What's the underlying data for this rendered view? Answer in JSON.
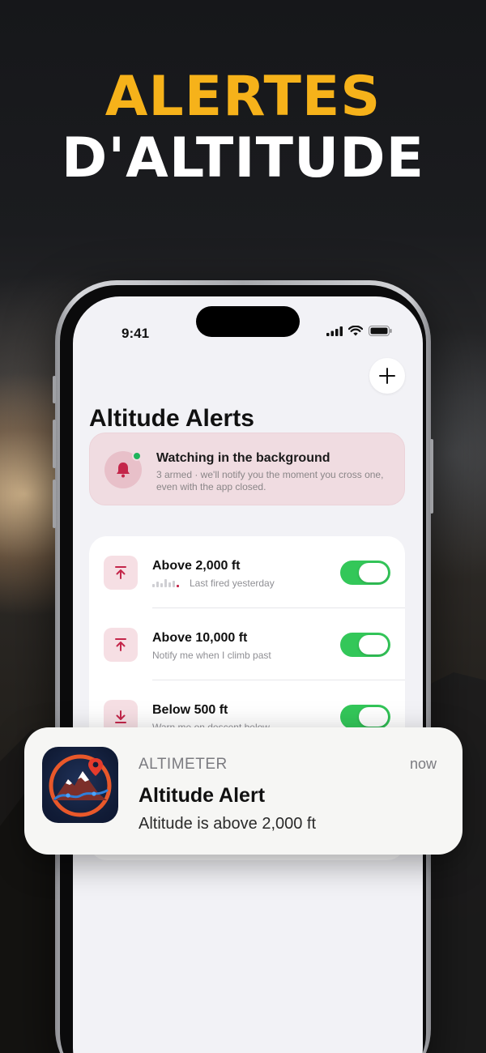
{
  "headline": {
    "line1": "ALERTES",
    "line2": "D'ALTITUDE"
  },
  "status_bar": {
    "time": "9:41"
  },
  "page": {
    "title": "Altitude Alerts"
  },
  "banner": {
    "title": "Watching in the background",
    "subtitle": "3 armed · we'll notify you the moment you cross one, even with the app closed.",
    "status_dot_color": "#1fb35b"
  },
  "alerts": [
    {
      "title": "Above 2,000 ft",
      "subtitle": "Last fired yesterday",
      "direction": "up",
      "enabled": true
    },
    {
      "title": "Above 10,000 ft",
      "subtitle": "Notify me when I climb past",
      "direction": "up",
      "enabled": true
    },
    {
      "title": "Below 500 ft",
      "subtitle": "Warn me on descent below",
      "direction": "down",
      "enabled": true
    }
  ],
  "notification": {
    "app_name": "ALTIMETER",
    "time": "now",
    "title": "Altitude Alert",
    "body": "Altitude is above 2,000 ft"
  },
  "colors": {
    "headline_accent": "#f6b21a",
    "toggle_on": "#33c759",
    "alert_icon": "#c4264a"
  }
}
